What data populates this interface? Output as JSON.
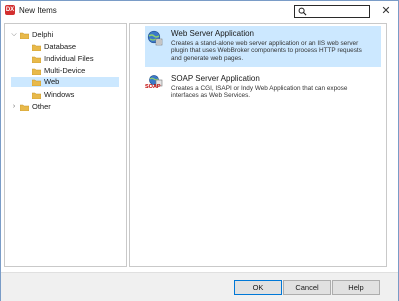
{
  "window": {
    "app_icon": "DX",
    "title": "New Items",
    "search_placeholder": "",
    "close_glyph": "✕"
  },
  "tree": {
    "items": [
      {
        "label": "Delphi",
        "expanded": true,
        "level": 0
      },
      {
        "label": "Database",
        "level": 1
      },
      {
        "label": "Individual Files",
        "level": 1
      },
      {
        "label": "Multi-Device",
        "level": 1
      },
      {
        "label": "Web",
        "level": 1,
        "selected": true
      },
      {
        "label": "Windows",
        "level": 1
      },
      {
        "label": "Other",
        "expanded": false,
        "level": 0
      }
    ]
  },
  "items": [
    {
      "title": "Web Server Application",
      "description": "Creates a stand-alone web server application or an IIS web server plugin that uses WebBroker components to process HTTP requests and generate web pages.",
      "icon": "globe-server-icon",
      "selected": true
    },
    {
      "title": "SOAP Server Application",
      "description": "Creates a CGI, ISAPI or Indy Web Application that can expose interfaces as Web Services.",
      "icon": "soap-server-icon",
      "icon_label": "SOAP",
      "selected": false
    }
  ],
  "footer": {
    "ok": "OK",
    "cancel": "Cancel",
    "help": "Help"
  },
  "colors": {
    "selection": "#cce8ff",
    "accent": "#0078d7",
    "footer_bg": "#f0f0f0",
    "folder": "#e8b94a",
    "soap_red": "#c00000"
  }
}
